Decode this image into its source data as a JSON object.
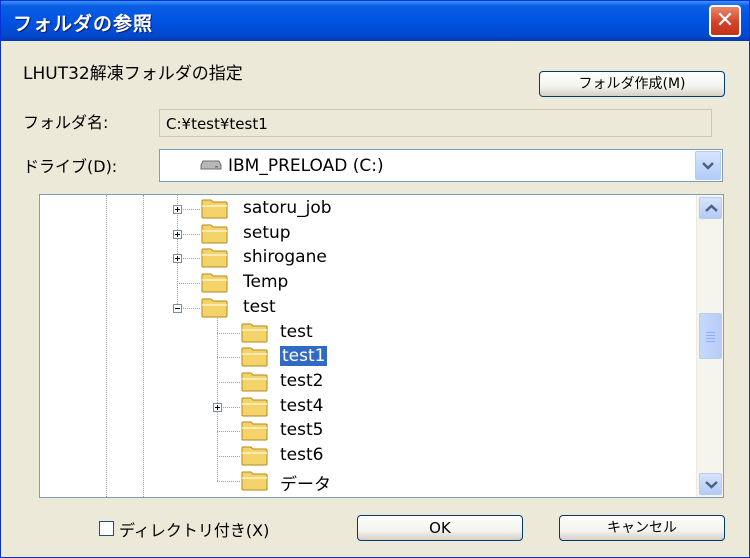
{
  "window": {
    "title": "フォルダの参照",
    "close_icon": "close-icon"
  },
  "header": {
    "description": "LHUT32解凍フォルダの指定",
    "create_folder_label": "フォルダ作成(M)"
  },
  "folder_name": {
    "label": "フォルダ名:",
    "value": "C:¥test¥test1"
  },
  "drive": {
    "label": "ドライブ(D):",
    "value": "IBM_PRELOAD (C:)",
    "icon": "drive-icon"
  },
  "tree": {
    "items": [
      {
        "label": "satoru_job",
        "expander": "plus"
      },
      {
        "label": "setup",
        "expander": "plus"
      },
      {
        "label": "shirogane",
        "expander": "plus"
      },
      {
        "label": "Temp",
        "expander": "none"
      },
      {
        "label": "test",
        "expander": "minus"
      },
      {
        "label": "test",
        "expander": "none"
      },
      {
        "label": "test1",
        "expander": "none",
        "selected": true
      },
      {
        "label": "test2",
        "expander": "none"
      },
      {
        "label": "test4",
        "expander": "plus"
      },
      {
        "label": "test5",
        "expander": "none"
      },
      {
        "label": "test6",
        "expander": "none"
      },
      {
        "label": "データ",
        "expander": "none"
      }
    ]
  },
  "footer": {
    "checkbox_label": "ディレクトリ付き(X)",
    "checkbox_checked": false,
    "ok_label": "OK",
    "cancel_label": "キャンセル"
  },
  "colors": {
    "titlebar": "#0054E3",
    "dialog_bg": "#ECE9D8",
    "selection": "#316AC5",
    "folder": "#F4D36A"
  }
}
